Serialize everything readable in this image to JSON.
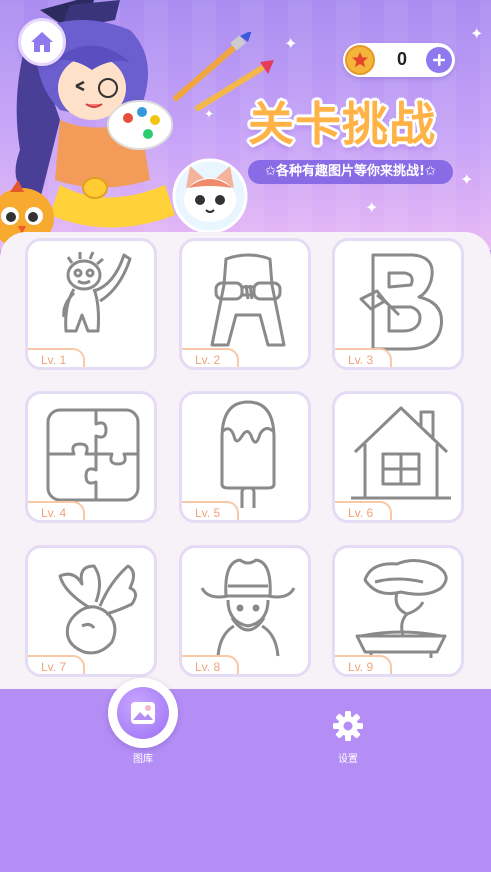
{
  "header": {
    "title": "关卡挑战",
    "subtitle": "✩各种有趣图片等你来挑战!✩",
    "coins": "0"
  },
  "levels": [
    {
      "label": "Lv. 1",
      "subject": "cartoon-figure-waving"
    },
    {
      "label": "Lv. 2",
      "subject": "letter-a-character"
    },
    {
      "label": "Lv. 3",
      "subject": "letter-b-character"
    },
    {
      "label": "Lv. 4",
      "subject": "jigsaw-puzzle"
    },
    {
      "label": "Lv. 5",
      "subject": "ice-pop"
    },
    {
      "label": "Lv. 6",
      "subject": "house"
    },
    {
      "label": "Lv. 7",
      "subject": "radish"
    },
    {
      "label": "Lv. 8",
      "subject": "cowboy"
    },
    {
      "label": "Lv. 9",
      "subject": "bonsai-tree"
    }
  ],
  "nav": {
    "gallery_label": "图库",
    "settings_label": "设置"
  },
  "colors": {
    "background": "#b48ef5",
    "panel": "#f7f1f8",
    "accent": "#8f79ee",
    "level_label": "#f0a27a"
  }
}
